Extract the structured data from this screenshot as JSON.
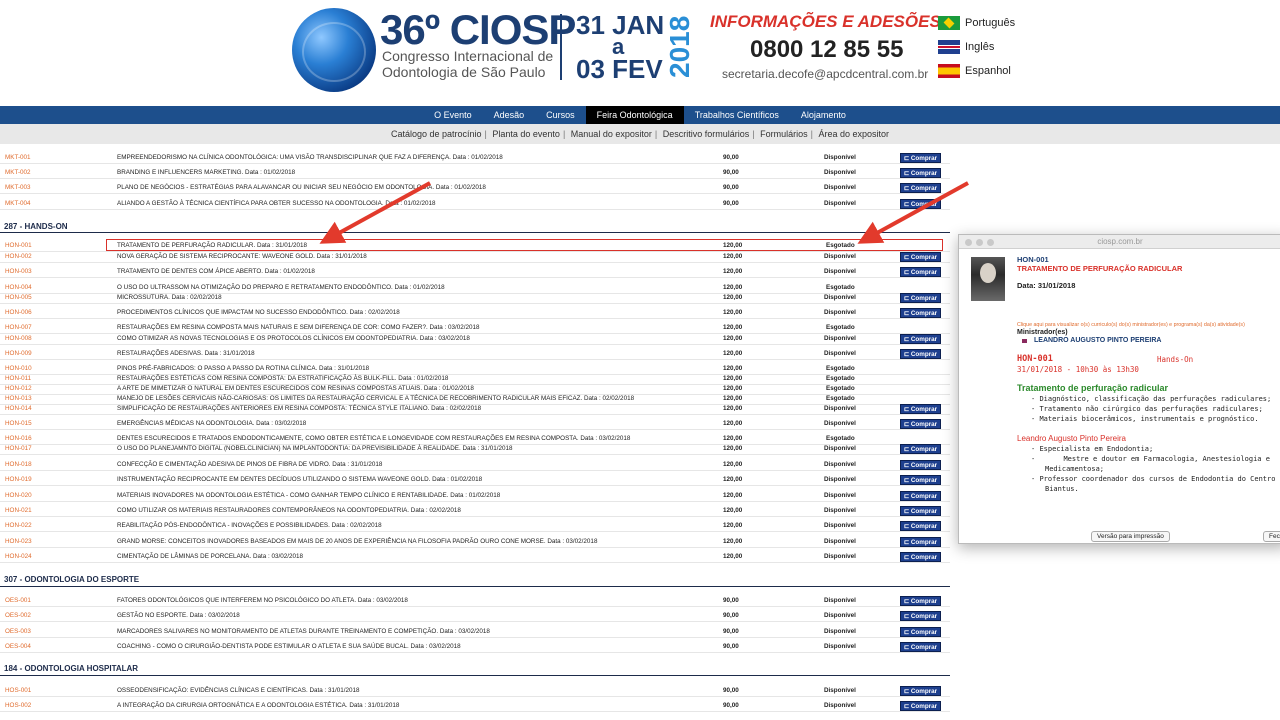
{
  "header": {
    "logo_number": "36º CIOSP",
    "logo_line1": "Congresso Internacional de",
    "logo_line2": "Odontologia de São Paulo",
    "date_line1": "31 JAN",
    "date_a": "a",
    "date_line2": "03 FEV",
    "date_year": "2018",
    "info_title": "INFORMAÇÕES E ADESÕES:",
    "phone": "0800 12 85 55",
    "email": "secretaria.decofe@apcdcentral.com.br",
    "languages": [
      "Português",
      "Inglês",
      "Espanhol"
    ]
  },
  "nav": {
    "items": [
      "O Evento",
      "Adesão",
      "Cursos",
      "Feira Odontológica",
      "Trabalhos Científicos",
      "Alojamento"
    ],
    "active": "Feira Odontológica"
  },
  "subnav": {
    "items": [
      "Catálogo de patrocínio",
      "Planta do evento",
      "Manual do expositor",
      "Descritivo formulários",
      "Formulários",
      "Área do expositor"
    ]
  },
  "buy_label": "Comprar",
  "sections": [
    {
      "title": "",
      "rows": [
        {
          "code": "MKT-001",
          "title": "EMPREENDEDORISMO NA CLÍNICA ODONTOLÓGICA: UMA VISÃO TRANSDISCIPLINAR QUE FAZ A DIFERENÇA. Data : 01/02/2018",
          "price": "90,00",
          "status": "Disponível",
          "buy": true
        },
        {
          "code": "MKT-002",
          "title": "BRANDING E INFLUENCERS MARKETING. Data : 01/02/2018",
          "price": "90,00",
          "status": "Disponível",
          "buy": true
        },
        {
          "code": "MKT-003",
          "title": "PLANO DE NEGÓCIOS - ESTRATÉGIAS PARA ALAVANCAR OU INICIAR SEU NEGÓCIO EM ODONTOLOGIA. Data : 01/02/2018",
          "price": "90,00",
          "status": "Disponível",
          "buy": true
        },
        {
          "code": "MKT-004",
          "title": "ALIANDO A GESTÃO À TÉCNICA CIENTÍFICA PARA OBTER SUCESSO NA ODONTOLOGIA. Data : 01/02/2018",
          "price": "90,00",
          "status": "Disponível",
          "buy": true
        }
      ]
    },
    {
      "title": "287 - HANDS-ON",
      "rows": [
        {
          "code": "HON-001",
          "title": "TRATAMENTO DE PERFURAÇÃO RADICULAR. Data : 31/01/2018",
          "price": "120,00",
          "status": "Esgotado",
          "buy": false
        },
        {
          "code": "HON-002",
          "title": "NOVA GERAÇÃO DE SISTEMA RECIPROCANTE: WAVEONE GOLD. Data : 31/01/2018",
          "price": "120,00",
          "status": "Disponível",
          "buy": true
        },
        {
          "code": "HON-003",
          "title": "TRATAMENTO DE DENTES COM ÁPICE ABERTO. Data : 01/02/2018",
          "price": "120,00",
          "status": "Disponível",
          "buy": true
        },
        {
          "code": "HON-004",
          "title": "O USO DO ULTRASSOM NA OTIMIZAÇÃO DO PREPARO E RETRATAMENTO ENDODÔNTICO. Data : 01/02/2018",
          "price": "120,00",
          "status": "Esgotado",
          "buy": false
        },
        {
          "code": "HON-005",
          "title": "MICROSSUTURA. Data : 02/02/2018",
          "price": "120,00",
          "status": "Disponível",
          "buy": true
        },
        {
          "code": "HON-006",
          "title": "PROCEDIMENTOS CLÍNICOS QUE IMPACTAM NO SUCESSO ENDODÔNTICO. Data : 02/02/2018",
          "price": "120,00",
          "status": "Disponível",
          "buy": true
        },
        {
          "code": "HON-007",
          "title": "RESTAURAÇÕES EM RESINA COMPOSTA MAIS NATURAIS E SEM DIFERENÇA DE COR: COMO FAZER?. Data : 03/02/2018",
          "price": "120,00",
          "status": "Esgotado",
          "buy": false
        },
        {
          "code": "HON-008",
          "title": "COMO OTIMIZAR AS NOVAS TECNOLOGIAS E OS PROTOCOLOS CLÍNICOS EM ODONTOPEDIATRIA. Data : 03/02/2018",
          "price": "120,00",
          "status": "Disponível",
          "buy": true
        },
        {
          "code": "HON-009",
          "title": "RESTAURAÇÕES ADESIVAS. Data : 31/01/2018",
          "price": "120,00",
          "status": "Disponível",
          "buy": true
        },
        {
          "code": "HON-010",
          "title": "PINOS PRÉ-FABRICADOS: O PASSO A PASSO DA ROTINA CLÍNICA. Data : 31/01/2018",
          "price": "120,00",
          "status": "Esgotado",
          "buy": false
        },
        {
          "code": "HON-011",
          "title": "RESTAURAÇÕES ESTÉTICAS COM RESINA COMPOSTA: DA ESTRATIFICAÇÃO ÀS BULK-FILL. Data : 01/02/2018",
          "price": "120,00",
          "status": "Esgotado",
          "buy": false
        },
        {
          "code": "HON-012",
          "title": "A ARTE DE MIMETIZAR O NATURAL EM DENTES ESCURECIDOS COM RESINAS COMPOSTAS ATUAIS. Data : 01/02/2018",
          "price": "120,00",
          "status": "Esgotado",
          "buy": false
        },
        {
          "code": "HON-013",
          "title": "MANEJO DE LESÕES CERVICAIS NÃO-CARIOSAS: OS LIMITES DA RESTAURAÇÃO CERVICAL E A TÉCNICA DE RECOBRIMENTO RADICULAR MAIS EFICAZ. Data : 02/02/2018",
          "price": "120,00",
          "status": "Esgotado",
          "buy": false
        },
        {
          "code": "HON-014",
          "title": "SIMPLIFICAÇÃO DE RESTAURAÇÕES ANTERIORES EM RESINA COMPOSTA: TÉCNICA STYLE ITALIANO. Data : 02/02/2018",
          "price": "120,00",
          "status": "Disponível",
          "buy": true
        },
        {
          "code": "HON-015",
          "title": "EMERGÊNCIAS MÉDICAS NA ODONTOLOGIA. Data : 03/02/2018",
          "price": "120,00",
          "status": "Disponível",
          "buy": true
        },
        {
          "code": "HON-016",
          "title": "DENTES ESCURECIDOS E TRATADOS ENDODONTICAMENTE, COMO OBTER ESTÉTICA E LONGEVIDADE COM RESTAURAÇÕES EM RESINA COMPOSTA. Data : 03/02/2018",
          "price": "120,00",
          "status": "Esgotado",
          "buy": false
        },
        {
          "code": "HON-017",
          "title": "O USO DO PLANEJAMNTO DIGITAL (NOBELCLINICIAN) NA IMPLANTODONTIA: DA PREVISIBILIDADE À REALIDADE. Data : 31/01/2018",
          "price": "120,00",
          "status": "Disponível",
          "buy": true
        },
        {
          "code": "HON-018",
          "title": "CONFECÇÃO E CIMENTAÇÃO ADESIVA DE PINOS DE FIBRA DE VIDRO. Data : 31/01/2018",
          "price": "120,00",
          "status": "Disponível",
          "buy": true
        },
        {
          "code": "HON-019",
          "title": "INSTRUMENTAÇÃO RECIPROCANTE EM DENTES DECÍDUOS UTILIZANDO O SISTEMA WAVEONE GOLD. Data : 01/02/2018",
          "price": "120,00",
          "status": "Disponível",
          "buy": true
        },
        {
          "code": "HON-020",
          "title": "MATERIAIS INOVADORES NA ODONTOLOGIA ESTÉTICA - COMO GANHAR TEMPO CLÍNICO E RENTABILIDADE. Data : 01/02/2018",
          "price": "120,00",
          "status": "Disponível",
          "buy": true
        },
        {
          "code": "HON-021",
          "title": "COMO UTILIZAR OS MATERIAIS RESTAURADORES CONTEMPORÂNEOS NA ODONTOPEDIATRIA. Data : 02/02/2018",
          "price": "120,00",
          "status": "Disponível",
          "buy": true
        },
        {
          "code": "HON-022",
          "title": "REABILITAÇÃO PÓS-ENDODÔNTICA - INOVAÇÕES E POSSIBILIDADES. Data : 02/02/2018",
          "price": "120,00",
          "status": "Disponível",
          "buy": true
        },
        {
          "code": "HON-023",
          "title": "GRAND MORSE: CONCEITOS INOVADORES BASEADOS EM MAIS DE 20 ANOS DE EXPERIÊNCIA NA FILOSOFIA PADRÃO OURO CONE MORSE. Data : 03/02/2018",
          "price": "120,00",
          "status": "Disponível",
          "buy": true
        },
        {
          "code": "HON-024",
          "title": "CIMENTAÇÃO DE LÂMINAS DE PORCELANA. Data : 03/02/2018",
          "price": "120,00",
          "status": "Disponível",
          "buy": true
        }
      ]
    },
    {
      "title": "307 - ODONTOLOGIA DO ESPORTE",
      "rows": [
        {
          "code": "OES-001",
          "title": "FATORES ODONTOLÓGICOS QUE INTERFEREM NO PSICOLÓGICO DO ATLETA. Data : 03/02/2018",
          "price": "90,00",
          "status": "Disponível",
          "buy": true
        },
        {
          "code": "OES-002",
          "title": "GESTÃO NO ESPORTE. Data : 03/02/2018",
          "price": "90,00",
          "status": "Disponível",
          "buy": true
        },
        {
          "code": "OES-003",
          "title": "MARCADORES SALIVARES NO MONITORAMENTO DE ATLETAS DURANTE TREINAMENTO E COMPETIÇÃO. Data : 03/02/2018",
          "price": "90,00",
          "status": "Disponível",
          "buy": true
        },
        {
          "code": "OES-004",
          "title": "COACHING - COMO O CIRURGIÃO-DENTISTA PODE ESTIMULAR O ATLETA E SUA SAÚDE BUCAL. Data : 03/02/2018",
          "price": "90,00",
          "status": "Disponível",
          "buy": true
        }
      ]
    },
    {
      "title": "184 - ODONTOLOGIA HOSPITALAR",
      "rows": [
        {
          "code": "HOS-001",
          "title": "OSSEODENSIFICAÇÃO: EVIDÊNCIAS CLÍNICAS E CIENTÍFICAS. Data : 31/01/2018",
          "price": "90,00",
          "status": "Disponível",
          "buy": true
        },
        {
          "code": "HOS-002",
          "title": "A INTEGRAÇÃO DA CIRURGIA ORTOGNÁTICA E A ODONTOLOGIA ESTÉTICA. Data : 31/01/2018",
          "price": "90,00",
          "status": "Disponível",
          "buy": true
        }
      ]
    }
  ],
  "popup": {
    "url": "ciosp.com.br",
    "code": "HON-001",
    "title": "TRATAMENTO DE PERFURAÇÃO RADICULAR",
    "date": "Data: 31/01/2018",
    "hint": "Clique aqui para visualizar o(s) curriculo(s) do(s) ministrador(es) e programa(s) da(s) atividade(s)",
    "minister_label": "Ministrador(es)",
    "minister_name": "LEANDRO AUGUSTO PINTO PEREIRA",
    "code2": "HON-001",
    "type": "Hands-On",
    "schedule": "31/01/2018 - 10h30 às 13h30",
    "topic": "Tratamento de perfuração radicular",
    "topic_items": [
      "Diagnóstico, classificação das perfurações radiculares;",
      "Tratamento não cirúrgico das perfurações radiculares;",
      "Materiais biocerâmicos, instrumentais e prognóstico."
    ],
    "professor": "Leandro Augusto Pinto Pereira",
    "professor_items": [
      "Especialista em Endodontia;",
      "Mestre e doutor em Farmacologia, Anestesiologia e",
      "Medicamentosa;",
      "Professor coordenador dos cursos de Endodontia do Centro",
      "Biantus."
    ],
    "print_button": "Versão para impressão",
    "close_button": "Fechar"
  }
}
